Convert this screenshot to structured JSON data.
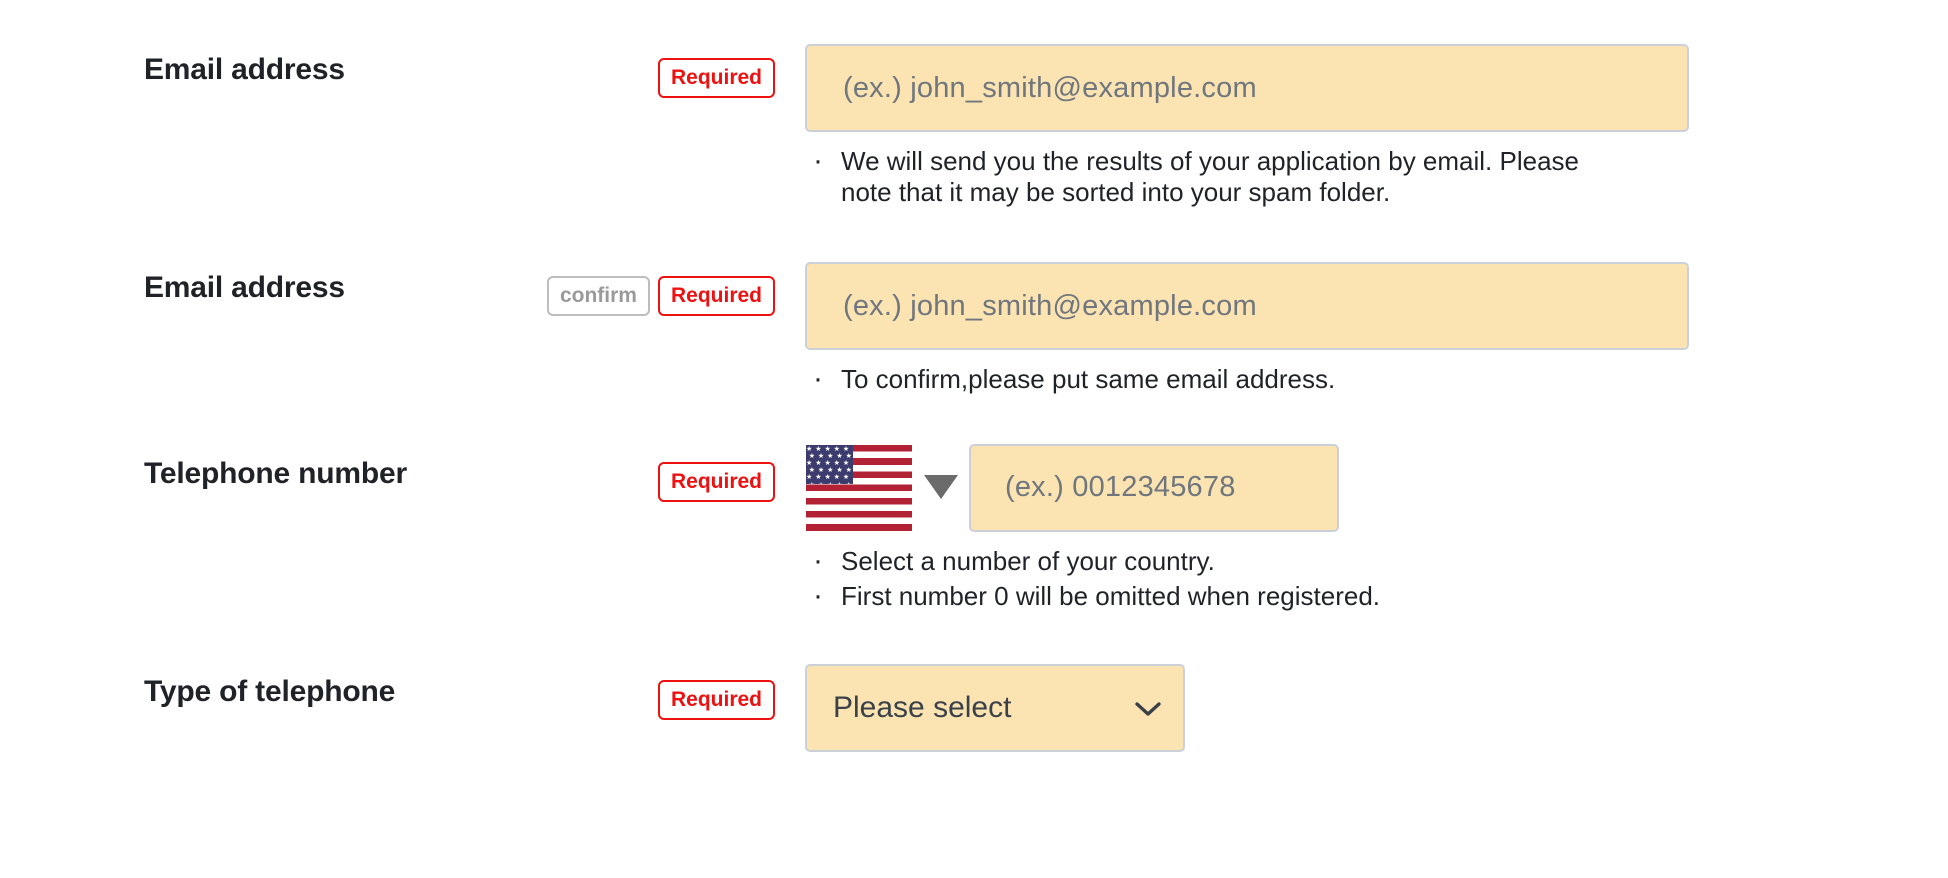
{
  "form": {
    "rows": [
      {
        "label": "Email address",
        "badges": [
          {
            "type": "required",
            "text": "Required"
          }
        ],
        "input": {
          "kind": "text",
          "placeholder": "(ex.)  john_smith@example.com",
          "value": ""
        },
        "hints": [
          "We will send you the results of your application by email. Please note that it may be sorted into your spam folder."
        ]
      },
      {
        "label": "Email address",
        "badges": [
          {
            "type": "confirm",
            "text": "confirm"
          },
          {
            "type": "required",
            "text": "Required"
          }
        ],
        "input": {
          "kind": "text",
          "placeholder": "(ex.)  john_smith@example.com",
          "value": ""
        },
        "hints": [
          "To confirm,please put same email address."
        ]
      },
      {
        "label": "Telephone number",
        "badges": [
          {
            "type": "required",
            "text": "Required"
          }
        ],
        "country_select": {
          "flag": "us-flag-icon",
          "country": "United States",
          "arrow": "triangle-down-icon"
        },
        "input": {
          "kind": "tel",
          "placeholder": "(ex.)  0012345678",
          "value": ""
        },
        "hints": [
          "Select a number of your country.",
          "First number 0 will be omitted when registered."
        ]
      },
      {
        "label": "Type of telephone",
        "badges": [
          {
            "type": "required",
            "text": "Required"
          }
        ],
        "select": {
          "selected": "Please select",
          "chevron": "chevron-down-icon"
        },
        "hints": []
      }
    ]
  },
  "colors": {
    "required_red": "#ee1111",
    "confirm_gray": "#9a9a9a",
    "input_background": "#fbe3b2",
    "input_border": "#ccd1d9",
    "placeholder_text": "#70767d",
    "label_text": "#1f2328"
  }
}
